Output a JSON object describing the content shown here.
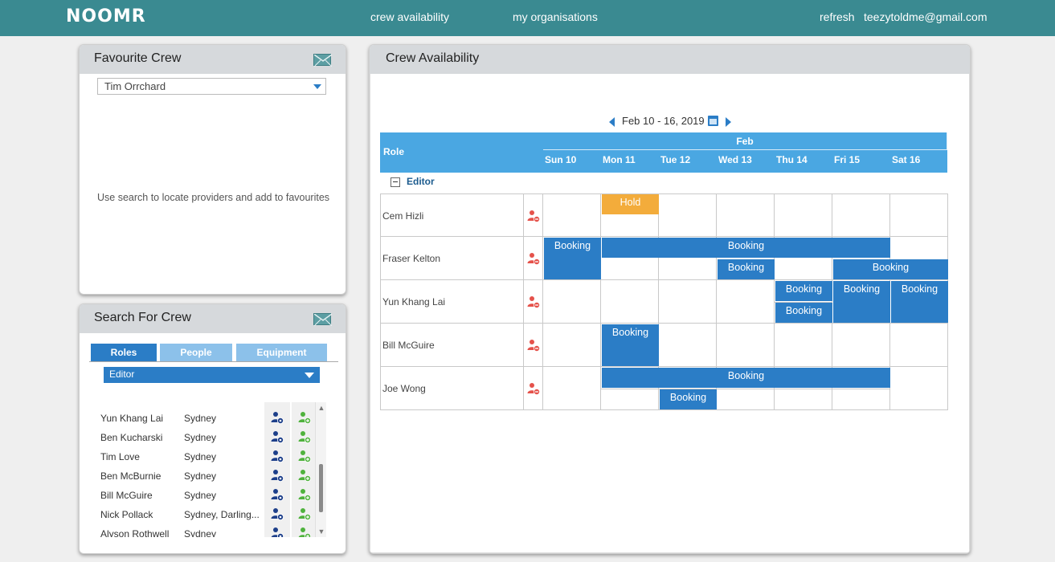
{
  "nav": {
    "logo": "NOOMR",
    "links": [
      "crew availability",
      "my organisations"
    ],
    "refresh": "refresh",
    "user": "teezytoldme@gmail.com"
  },
  "favourite": {
    "title": "Favourite Crew",
    "selected": "Tim Orrchard",
    "hint": "Use search to locate providers and add to favourites"
  },
  "search": {
    "title": "Search For Crew",
    "tabs": [
      "Roles",
      "People",
      "Equipment"
    ],
    "role": "Editor",
    "results": [
      {
        "name": "Yun Khang Lai",
        "location": "Sydney"
      },
      {
        "name": "Ben Kucharski",
        "location": "Sydney"
      },
      {
        "name": "Tim Love",
        "location": "Sydney"
      },
      {
        "name": "Ben McBurnie",
        "location": "Sydney"
      },
      {
        "name": "Bill McGuire",
        "location": "Sydney"
      },
      {
        "name": "Nick Pollack",
        "location": "Sydney, Darling..."
      },
      {
        "name": "Alyson Rothwell",
        "location": "Sydney"
      }
    ]
  },
  "availability": {
    "title": "Crew Availability",
    "range": "Feb 10 - 16, 2019",
    "role_header": "Role",
    "month": "Feb",
    "days": [
      "Sun 10",
      "Mon 11",
      "Tue 12",
      "Wed 13",
      "Thu 14",
      "Fri 15",
      "Sat 16"
    ],
    "group": "Editor",
    "crew": [
      "Cem Hizli",
      "Fraser Kelton",
      "Yun Khang Lai",
      "Bill McGuire",
      "Joe Wong"
    ],
    "events": [
      {
        "row": 0,
        "start": 1,
        "span": 1,
        "slot": 0,
        "label": "Hold",
        "kind": "hold"
      },
      {
        "row": 1,
        "start": 0,
        "span": 1,
        "slot": 0,
        "tall": true,
        "label": "Booking",
        "kind": "booking"
      },
      {
        "row": 1,
        "start": 1,
        "span": 5,
        "slot": 0,
        "label": "Booking",
        "kind": "booking"
      },
      {
        "row": 1,
        "start": 3,
        "span": 1,
        "slot": 1,
        "label": "Booking",
        "kind": "booking"
      },
      {
        "row": 1,
        "start": 5,
        "span": 2,
        "slot": 1,
        "label": "Booking",
        "kind": "booking"
      },
      {
        "row": 2,
        "start": 4,
        "span": 1,
        "slot": 0,
        "label": "Booking",
        "kind": "booking"
      },
      {
        "row": 2,
        "start": 4,
        "span": 1,
        "slot": 1,
        "label": "Booking",
        "kind": "booking"
      },
      {
        "row": 2,
        "start": 5,
        "span": 1,
        "slot": 0,
        "tall": true,
        "label": "Booking",
        "kind": "booking"
      },
      {
        "row": 2,
        "start": 6,
        "span": 1,
        "slot": 0,
        "tall": true,
        "label": "Booking",
        "kind": "booking"
      },
      {
        "row": 3,
        "start": 1,
        "span": 1,
        "slot": 0,
        "tall": true,
        "label": "Booking",
        "kind": "booking"
      },
      {
        "row": 4,
        "start": 1,
        "span": 5,
        "slot": 0,
        "label": "Booking",
        "kind": "booking"
      },
      {
        "row": 4,
        "start": 2,
        "span": 1,
        "slot": 1,
        "label": "Booking",
        "kind": "booking"
      }
    ]
  },
  "colors": {
    "topbar": "#3a8a91",
    "booking": "#2b7dc6",
    "hold": "#f3ac3b",
    "header": "#4aa7e2"
  }
}
